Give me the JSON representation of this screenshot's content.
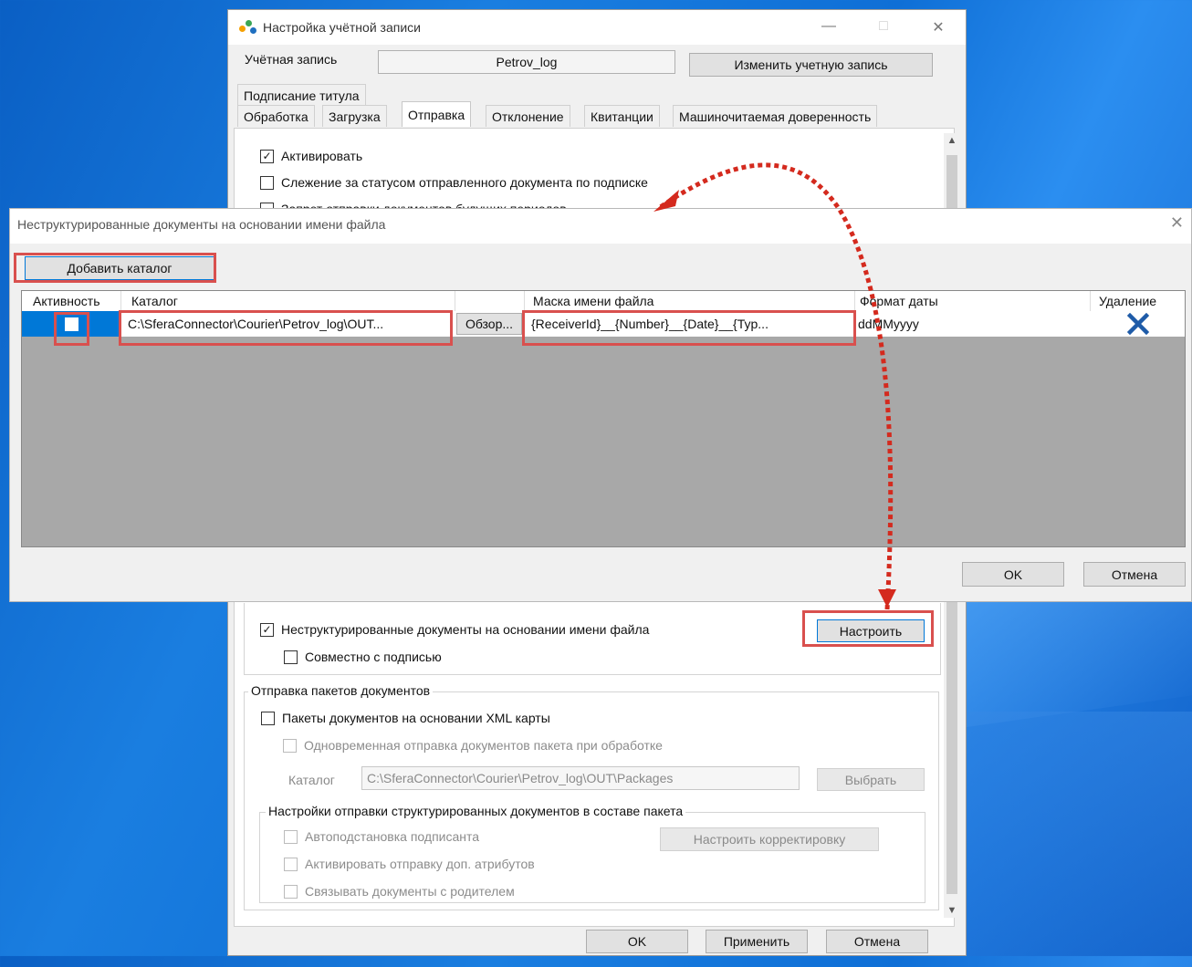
{
  "main_window": {
    "title": "Настройка учётной записи",
    "controls": {
      "minimize": "—",
      "maximize": "□",
      "close": "✕"
    },
    "account_label": "Учётная запись",
    "account_value": "Petrov_log",
    "change_account_button": "Изменить учетную запись",
    "tabs_row1": [
      "Подписание титула"
    ],
    "tabs_row2": [
      "Обработка",
      "Загрузка",
      "Отправка",
      "Отклонение",
      "Квитанции",
      "Машиночитаемая доверенность"
    ],
    "active_tab": "Отправка",
    "options_top": [
      {
        "label": "Активировать",
        "checked": true
      },
      {
        "label": "Слежение за статусом отправленного документа по подписке",
        "checked": false
      },
      {
        "label": "Запрет отправки документов будущих периодов",
        "checked": false
      }
    ],
    "unstructured": {
      "label": "Неструктурированные документы на основании имени файла",
      "checked": true,
      "configure_button": "Настроить"
    },
    "jointly_with_signature": {
      "label": "Совместно с подписью",
      "checked": false
    },
    "packages_group": {
      "title": "Отправка пакетов документов",
      "xml_packages": {
        "label": "Пакеты документов на основании XML карты",
        "checked": false
      },
      "simultaneous": {
        "label": "Одновременная отправка документов пакета при обработке",
        "checked": false
      },
      "catalog_label": "Каталог",
      "catalog_value": "C:\\SferaConnector\\Courier\\Petrov_log\\OUT\\Packages",
      "select_button": "Выбрать",
      "structured_group": {
        "title": "Настройки отправки структурированных документов в составе пакета",
        "auto_signer": "Автоподстановка подписанта",
        "extra_attrs": "Активировать отправку доп. атрибутов",
        "link_parent": "Связывать документы с родителем",
        "correction_button": "Настроить корректировку"
      }
    },
    "footer": {
      "ok": "OK",
      "apply": "Применить",
      "cancel": "Отмена"
    }
  },
  "dialog": {
    "title": "Неструктурированные документы на основании имени файла",
    "close": "✕",
    "add_catalog_button": "Добавить каталог",
    "columns": [
      "Активность",
      "Каталог",
      "Маска имени файла",
      "Формат даты",
      "Удаление"
    ],
    "rows": [
      {
        "active": false,
        "catalog": "C:\\SferaConnector\\Courier\\Petrov_log\\OUT...",
        "browse": "Обзор...",
        "mask": "{ReceiverId}__{Number}__{Date}__{Typ...",
        "date_format": "ddMMyyyy",
        "delete_icon": "blue-x"
      }
    ],
    "ok": "OK",
    "cancel": "Отмена"
  },
  "colors": {
    "highlight": "#d9504e",
    "selection": "#0078d7",
    "delete": "#1e5ba8"
  }
}
